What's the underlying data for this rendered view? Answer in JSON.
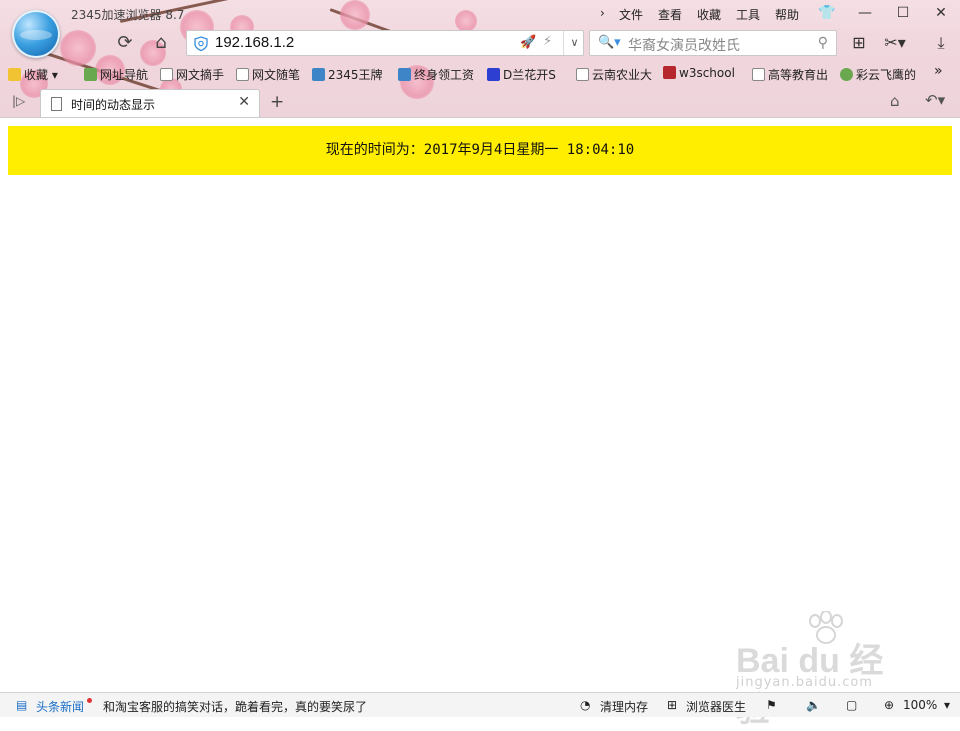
{
  "window": {
    "title": "2345加速浏览器 8.7",
    "menu": [
      "文件",
      "查看",
      "收藏",
      "工具",
      "帮助"
    ]
  },
  "addressbar": {
    "url": "192.168.1.2"
  },
  "search": {
    "placeholder": "华裔女演员改姓氏"
  },
  "bookmarks": [
    {
      "label": "收藏",
      "icon": "star-icon"
    },
    {
      "label": "网址导航",
      "icon": "nav-2345-icon"
    },
    {
      "label": "网文摘手",
      "icon": "page-icon"
    },
    {
      "label": "网文随笔",
      "icon": "page-icon"
    },
    {
      "label": "2345王牌",
      "icon": "app-2345-icon"
    },
    {
      "label": "终身领工资",
      "icon": "app-2345-icon"
    },
    {
      "label": "D兰花开S",
      "icon": "baidu-paw-icon"
    },
    {
      "label": "云南农业大",
      "icon": "page-icon"
    },
    {
      "label": "w3school",
      "icon": "w3school-icon"
    },
    {
      "label": "高等教育出",
      "icon": "page-icon"
    },
    {
      "label": "彩云飞鹰的",
      "icon": "iqiyi-icon"
    }
  ],
  "tab": {
    "title": "时间的动态显示"
  },
  "page": {
    "banner_text": "现在的时间为：2017年9月4日星期一 18:04:10",
    "banner_color": "#ffee00"
  },
  "watermark": {
    "main": "Bai du 经验",
    "sub": "jingyan.baidu.com"
  },
  "statusbar": {
    "news_label": "头条新闻",
    "news_text": "和淘宝客服的搞笑对话，跪着看完，真的要笑尿了",
    "clean_memory": "清理内存",
    "browser_doctor": "浏览器医生",
    "zoom": "100%"
  }
}
